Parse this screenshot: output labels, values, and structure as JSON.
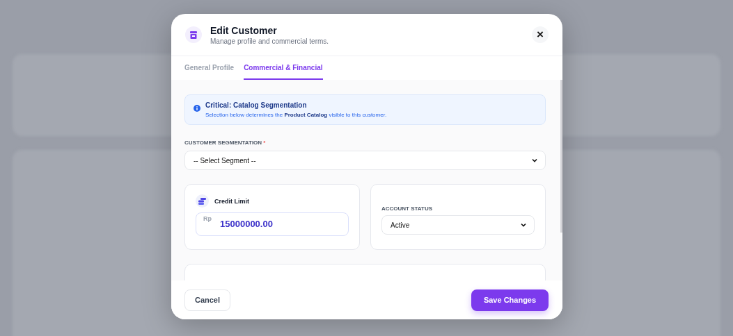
{
  "dialog": {
    "title": "Edit Customer",
    "subtitle": "Manage profile and commercial terms.",
    "close": "×"
  },
  "tabs": [
    {
      "label": "General Profile",
      "selected": false
    },
    {
      "label": "Commercial & Financial",
      "selected": true
    }
  ],
  "notice": {
    "title": "Critical: Catalog Segmentation",
    "text": "Selection below determines the **Product Catalog** visible to this customer."
  },
  "segmentation": {
    "label": "CUSTOMER SEGMENTATION",
    "required_mark": "*",
    "value": "-- Select Segment --"
  },
  "credit": {
    "title": "Credit Limit",
    "prefix": "Rp",
    "value": "15000000.00"
  },
  "account_status": {
    "label": "ACCOUNT STATUS",
    "value": "Active"
  },
  "footer": {
    "cancel": "Cancel",
    "save": "Save Changes"
  }
}
